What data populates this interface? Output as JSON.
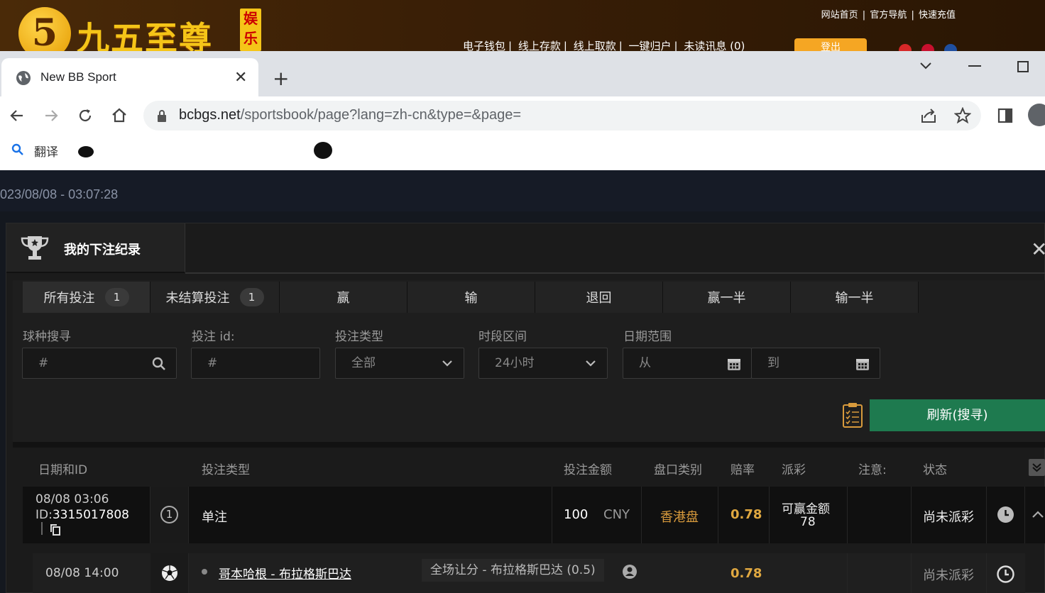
{
  "site": {
    "logo_text": "九五至尊",
    "logo_badge": "娱乐",
    "top_links": [
      "网站首页",
      "官方导航",
      "快速充值"
    ],
    "nav": [
      "电子钱包",
      "线上存款",
      "线上取款",
      "一键归户",
      "未读讯息 (0)"
    ],
    "login": "登出"
  },
  "browser": {
    "tab_title": "New BB Sport",
    "url_host": "bcbgs.net",
    "url_path": "/sportsbook/page?lang=zh-cn&type=&page=",
    "bookmark_label": "翻译"
  },
  "page": {
    "datetime": "023/08/08 - 03:07:28",
    "panel_title": "我的下注纪录",
    "tabs": [
      {
        "label": "所有投注",
        "count": "1"
      },
      {
        "label": "未结算投注",
        "count": "1"
      },
      {
        "label": "赢"
      },
      {
        "label": "输"
      },
      {
        "label": "退回"
      },
      {
        "label": "赢一半"
      },
      {
        "label": "输一半"
      }
    ],
    "filters": {
      "sport_label": "球种搜寻",
      "sport_placeholder": "#",
      "betid_label": "投注 id:",
      "betid_placeholder": "#",
      "bettype_label": "投注类型",
      "bettype_value": "全部",
      "period_label": "时段区间",
      "period_value": "24小时",
      "date_label": "日期范围",
      "date_from": "从",
      "date_to": "到"
    },
    "refresh_button": "刷新(搜寻)",
    "columns": [
      "日期和ID",
      "投注类型",
      "投注金额",
      "盘口类别",
      "赔率",
      "派彩",
      "注意:",
      "状态"
    ],
    "bet": {
      "date": "08/08 03:06",
      "id_prefix": "ID:",
      "id": "3315017808",
      "index": "1",
      "type": "单注",
      "amount": "100",
      "currency": "CNY",
      "market": "香港盘",
      "odds": "0.78",
      "payout_label": "可赢金额",
      "payout_value": "78",
      "status": "尚未派彩"
    },
    "selection": {
      "date": "08/08 14:00",
      "match": "哥本哈根 - 布拉格斯巴达",
      "pick": "全场让分 - 布拉格斯巴达 (0.5)",
      "odds": "0.78",
      "status": "尚未派彩"
    }
  }
}
